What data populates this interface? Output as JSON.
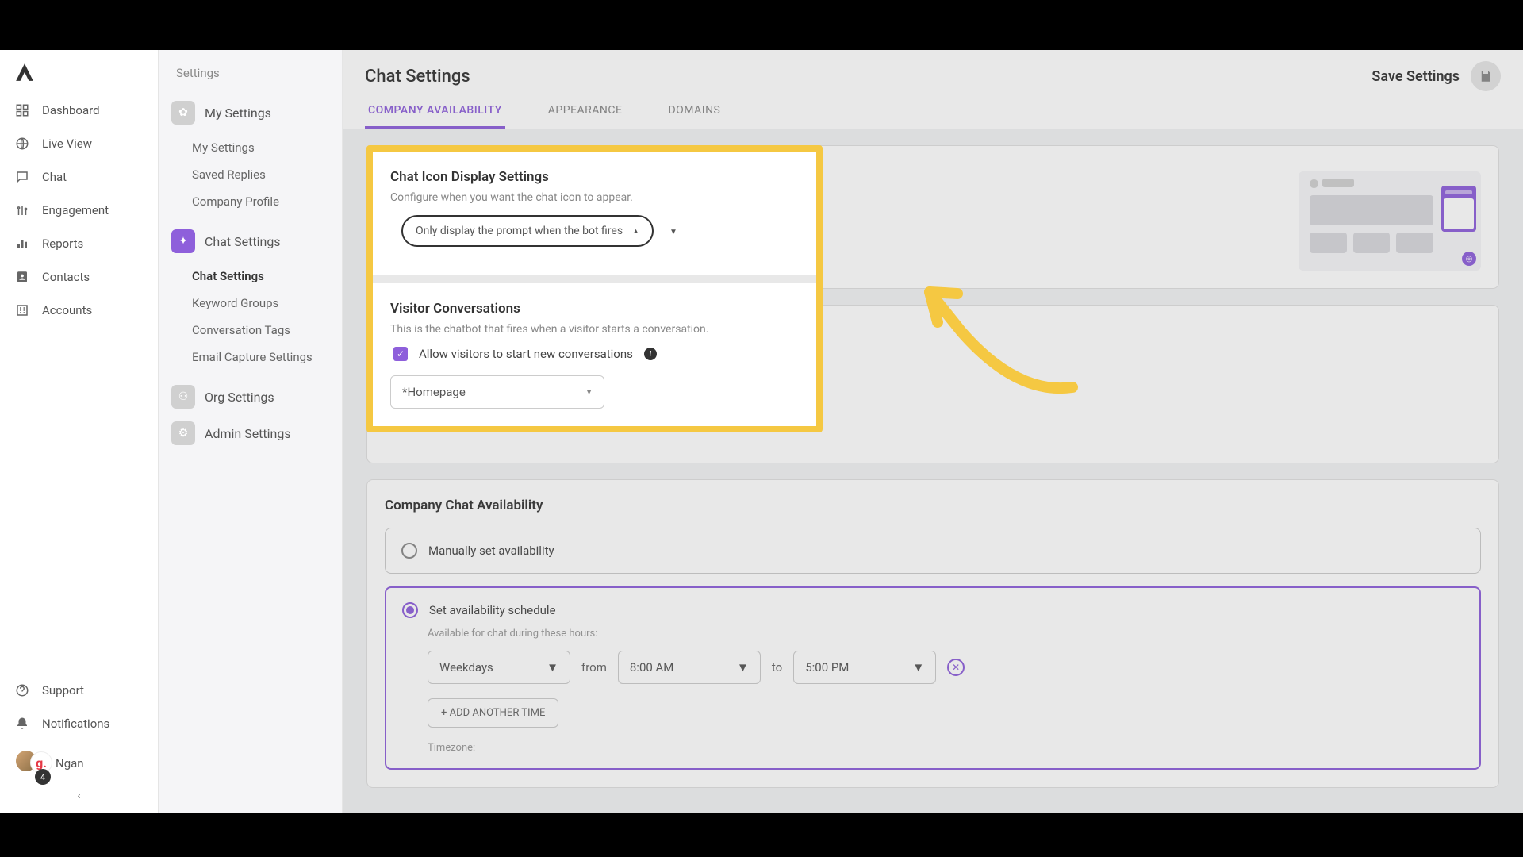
{
  "nav": {
    "items": [
      {
        "label": "Dashboard"
      },
      {
        "label": "Live View"
      },
      {
        "label": "Chat"
      },
      {
        "label": "Engagement"
      },
      {
        "label": "Reports"
      },
      {
        "label": "Contacts"
      },
      {
        "label": "Accounts"
      }
    ],
    "bottom": {
      "support": "Support",
      "notifications": "Notifications",
      "user_name": "Ngan",
      "user_badge": "g.",
      "count": "4"
    }
  },
  "settings_sidebar": {
    "title": "Settings",
    "groups": {
      "my_settings": {
        "label": "My Settings",
        "items": [
          "My Settings",
          "Saved Replies",
          "Company Profile"
        ]
      },
      "chat_settings": {
        "label": "Chat Settings",
        "items": [
          "Chat Settings",
          "Keyword Groups",
          "Conversation Tags",
          "Email Capture Settings"
        ]
      },
      "org_settings": {
        "label": "Org Settings"
      },
      "admin_settings": {
        "label": "Admin Settings"
      }
    }
  },
  "header": {
    "title": "Chat Settings",
    "save_label": "Save Settings",
    "tabs": [
      "COMPANY AVAILABILITY",
      "APPEARANCE",
      "DOMAINS"
    ]
  },
  "card_icon": {
    "title": "Chat Icon Display Settings",
    "desc": "Configure when you want the chat icon to appear.",
    "select_value": "Only display the prompt when the bot fires"
  },
  "card_visitor": {
    "title": "Visitor Conversations",
    "desc": "This is the chatbot that fires when a visitor starts a conversation.",
    "checkbox_label": "Allow visitors to start new conversations",
    "select_value": "*Homepage"
  },
  "card_avail": {
    "title": "Company Chat Availability",
    "manual_label": "Manually set availability",
    "schedule_label": "Set availability schedule",
    "schedule_desc": "Available for chat during these hours:",
    "days_value": "Weekdays",
    "from_label": "from",
    "from_value": "8:00 AM",
    "to_label": "to",
    "to_value": "5:00 PM",
    "add_btn": "+ ADD ANOTHER TIME",
    "tz_label": "Timezone:"
  }
}
